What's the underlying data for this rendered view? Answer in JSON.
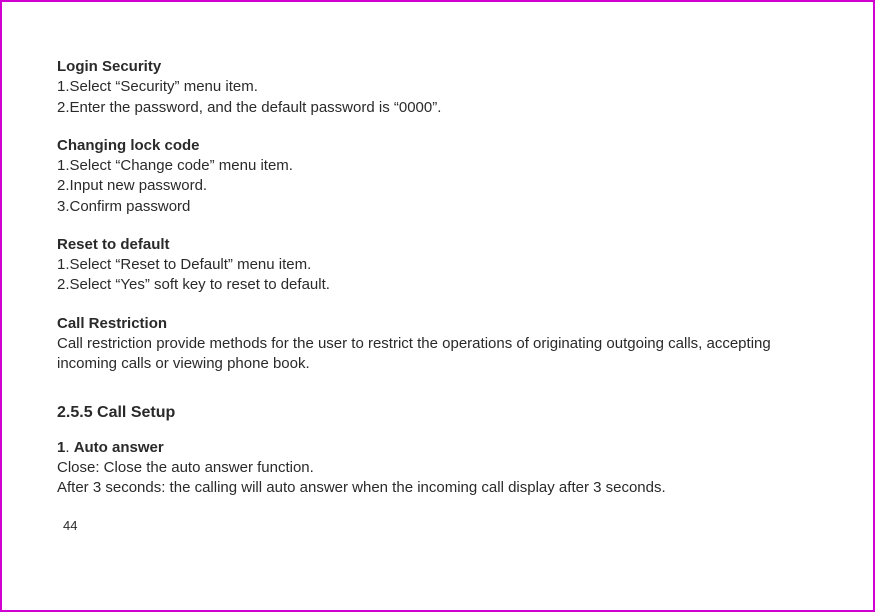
{
  "loginSecurity": {
    "heading": "Login Security",
    "item1": "1.Select “Security” menu item.",
    "item2": "2.Enter the password, and the default password is “0000”."
  },
  "changingLock": {
    "heading": "Changing lock code",
    "item1": "1.Select “Change code” menu item.",
    "item2": "2.Input new password.",
    "item3": "3.Confirm password"
  },
  "resetDefault": {
    "heading": "Reset to default",
    "item1": "1.Select “Reset to Default” menu item.",
    "item2": "2.Select “Yes” soft key to reset to default."
  },
  "callRestriction": {
    "heading": "Call Restriction",
    "body": "Call restriction provide methods for the user to restrict the operations of originating outgoing calls, accepting incoming calls or viewing phone book."
  },
  "callSetup": {
    "sectionTitle": "2.5.5 Call Setup"
  },
  "autoAnswer": {
    "num": "1",
    "dot": ". ",
    "heading": "Auto answer",
    "line1": "Close: Close the auto answer function.",
    "line2": "After 3 seconds: the calling will auto answer when the incoming call display after 3 seconds."
  },
  "pageNumber": "44"
}
